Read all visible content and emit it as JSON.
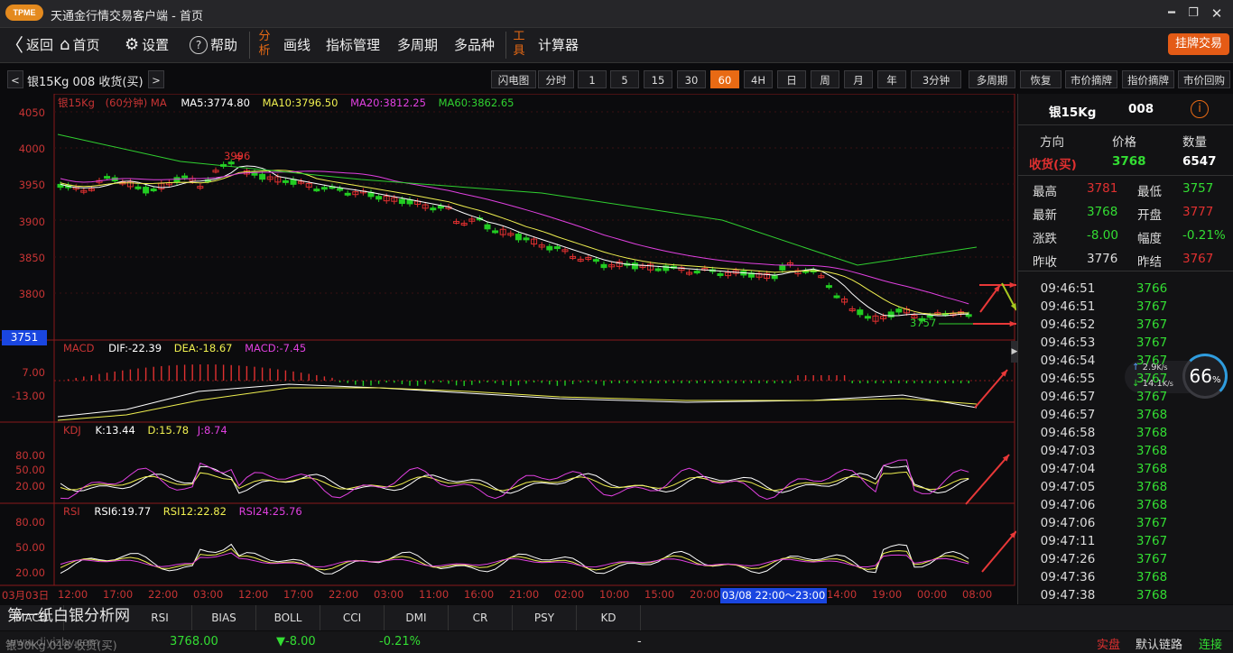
{
  "window": {
    "logo": "TPME",
    "title": "天通金行情交易客户端 - 首页"
  },
  "menu": {
    "back": "返回",
    "home": "首页",
    "settings": "设置",
    "help": "帮助",
    "analysis": "分析",
    "draw": "画线",
    "indicators": "指标管理",
    "multi_period": "多周期",
    "multi_product": "多品种",
    "tools": "工具",
    "calculator": "计算器",
    "trade_button": "挂牌交易"
  },
  "toolbar": {
    "prev": "<",
    "next": ">",
    "symbol": "银15Kg 008 收货(买)",
    "periods": [
      "闪电图",
      "分时",
      "1",
      "5",
      "15",
      "30",
      "60",
      "4H",
      "日",
      "周",
      "月",
      "年",
      "3分钟"
    ],
    "active_period": "60",
    "actions": [
      "多周期",
      "恢复",
      "市价摘牌",
      "指价摘牌",
      "市价回购"
    ]
  },
  "main_chart": {
    "legend": {
      "name": "银15Kg",
      "period": "(60分钟) MA",
      "ma5": "MA5:3774.80",
      "ma10": "MA10:3796.50",
      "ma20": "MA20:3812.25",
      "ma60": "MA60:3862.65"
    },
    "y_ticks": [
      "4050",
      "4000",
      "3950",
      "3900",
      "3850",
      "3800"
    ],
    "current_price_tag": "3751",
    "high_label": "3996",
    "low_label": "3757"
  },
  "macd": {
    "legend": {
      "name": "MACD",
      "dif": "DIF:-22.39",
      "dea": "DEA:-18.67",
      "macd": "MACD:-7.45"
    },
    "y_ticks": [
      "7.00",
      "-13.00"
    ]
  },
  "kdj": {
    "legend": {
      "name": "KDJ",
      "k": "K:13.44",
      "d": "D:15.78",
      "j": "J:8.74"
    },
    "y_ticks": [
      "80.00",
      "50.00",
      "20.00"
    ]
  },
  "rsi": {
    "legend": {
      "name": "RSI",
      "rsi6": "RSI6:19.77",
      "rsi12": "RSI12:22.82",
      "rsi24": "RSI24:25.76"
    },
    "y_ticks": [
      "80.00",
      "50.00",
      "20.00"
    ]
  },
  "x_axis": {
    "labels": [
      "03月03日",
      "12:00",
      "17:00",
      "22:00",
      "03:00",
      "12:00",
      "17:00",
      "22:00",
      "03:00",
      "11:00",
      "16:00",
      "21:00",
      "02:00",
      "10:00",
      "15:00",
      "20:00",
      "14:00",
      "19:00",
      "00:00",
      "08:00"
    ],
    "crosshair_label": "03/08 22:00～23:00"
  },
  "quote_panel": {
    "symbol": "银15Kg",
    "code": "008",
    "headers": {
      "direction": "方向",
      "price": "价格",
      "quantity": "数量"
    },
    "direction": "收货(买)",
    "price": "3768",
    "quantity": "6547",
    "rows": [
      {
        "l1": "最高",
        "v1": "3781",
        "l2": "最低",
        "v2": "3757"
      },
      {
        "l1": "最新",
        "v1": "3768",
        "l2": "开盘",
        "v2": "3777"
      },
      {
        "l1": "涨跌",
        "v1": "-8.00",
        "l2": "幅度",
        "v2": "-0.21%"
      },
      {
        "l1": "昨收",
        "v1": "3776",
        "l2": "昨结",
        "v2": "3767"
      }
    ]
  },
  "ticks": [
    {
      "time": "09:46:51",
      "price": "3766"
    },
    {
      "time": "09:46:51",
      "price": "3767"
    },
    {
      "time": "09:46:52",
      "price": "3767"
    },
    {
      "time": "09:46:53",
      "price": "3767"
    },
    {
      "time": "09:46:54",
      "price": "3767"
    },
    {
      "time": "09:46:55",
      "price": "3767"
    },
    {
      "time": "09:46:57",
      "price": "3767"
    },
    {
      "time": "09:46:57",
      "price": "3768"
    },
    {
      "time": "09:46:58",
      "price": "3768"
    },
    {
      "time": "09:47:03",
      "price": "3768"
    },
    {
      "time": "09:47:04",
      "price": "3768"
    },
    {
      "time": "09:47:05",
      "price": "3768"
    },
    {
      "time": "09:47:06",
      "price": "3768"
    },
    {
      "time": "09:47:06",
      "price": "3767"
    },
    {
      "time": "09:47:11",
      "price": "3767"
    },
    {
      "time": "09:47:26",
      "price": "3767"
    },
    {
      "time": "09:47:36",
      "price": "3768"
    },
    {
      "time": "09:47:38",
      "price": "3768"
    }
  ],
  "net_widget": {
    "up": "2.9",
    "up_unit": "K/s",
    "down": "14.1",
    "down_unit": "K/s",
    "percent": "66",
    "percent_unit": "%"
  },
  "indicator_tabs": [
    "MACD",
    "KD",
    "RSI",
    "BIAS",
    "BOLL",
    "CCI",
    "DMI",
    "CR",
    "PSY",
    "KD"
  ],
  "watermark": {
    "line1": "第一纸白银分析网",
    "line2": "www.diyizby.com"
  },
  "status": {
    "symbol": "银30Kg 018 收货(买)",
    "price": "3768.00",
    "change": "▼-8.00",
    "change_pct": "-0.21%",
    "dash": "-",
    "mode": "实盘",
    "link": "默认链路",
    "conn": "连接"
  },
  "colors": {
    "up": "#e03030",
    "down": "#22cc22",
    "accent": "#e86a14"
  }
}
